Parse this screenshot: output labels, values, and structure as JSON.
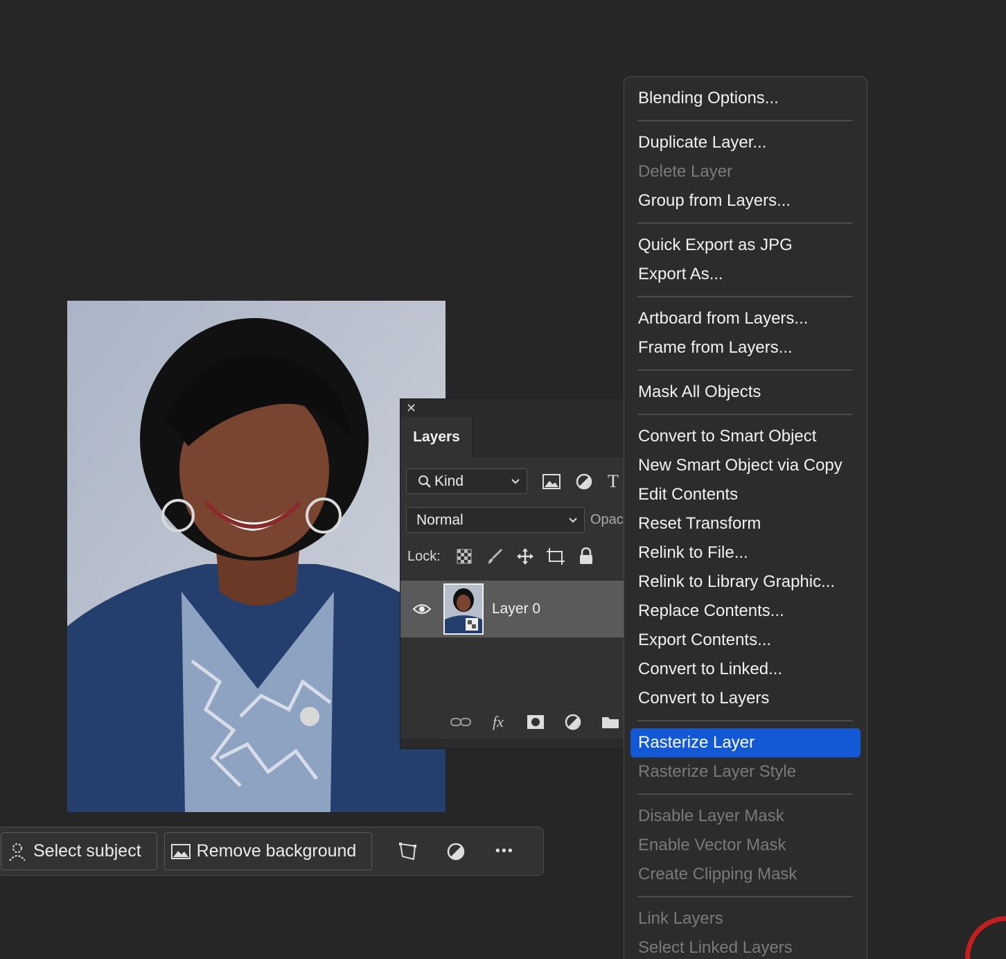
{
  "layers_panel": {
    "close_glyph": "✕",
    "tab_label": "Layers",
    "filter_kind": "Kind",
    "blend_mode": "Normal",
    "opacity_label": "Opac",
    "lock_label": "Lock:",
    "layer_name": "Layer 0"
  },
  "taskbar": {
    "select_subject": "Select subject",
    "remove_background": "Remove background",
    "more_glyph": "•••"
  },
  "context_menu": {
    "groups": [
      [
        {
          "label": "Blending Options...",
          "enabled": true
        }
      ],
      [
        {
          "label": "Duplicate Layer...",
          "enabled": true
        },
        {
          "label": "Delete Layer",
          "enabled": false
        },
        {
          "label": "Group from Layers...",
          "enabled": true
        }
      ],
      [
        {
          "label": "Quick Export as JPG",
          "enabled": true
        },
        {
          "label": "Export As...",
          "enabled": true
        }
      ],
      [
        {
          "label": "Artboard from Layers...",
          "enabled": true
        },
        {
          "label": "Frame from Layers...",
          "enabled": true
        }
      ],
      [
        {
          "label": "Mask All Objects",
          "enabled": true
        }
      ],
      [
        {
          "label": "Convert to Smart Object",
          "enabled": true
        },
        {
          "label": "New Smart Object via Copy",
          "enabled": true
        },
        {
          "label": "Edit Contents",
          "enabled": true
        },
        {
          "label": "Reset Transform",
          "enabled": true
        },
        {
          "label": "Relink to File...",
          "enabled": true
        },
        {
          "label": "Relink to Library Graphic...",
          "enabled": true
        },
        {
          "label": "Replace Contents...",
          "enabled": true
        },
        {
          "label": "Export Contents...",
          "enabled": true
        },
        {
          "label": "Convert to Linked...",
          "enabled": true
        },
        {
          "label": "Convert to Layers",
          "enabled": true
        }
      ],
      [
        {
          "label": "Rasterize Layer",
          "enabled": true,
          "highlighted": true
        },
        {
          "label": "Rasterize Layer Style",
          "enabled": false
        }
      ],
      [
        {
          "label": "Disable Layer Mask",
          "enabled": false
        },
        {
          "label": "Enable Vector Mask",
          "enabled": false
        },
        {
          "label": "Create Clipping Mask",
          "enabled": false
        }
      ],
      [
        {
          "label": "Link Layers",
          "enabled": false
        },
        {
          "label": "Select Linked Layers",
          "enabled": false
        }
      ]
    ]
  },
  "colors": {
    "highlight": "#1359d6",
    "background": "#262626",
    "ring": "#c41e1e"
  }
}
